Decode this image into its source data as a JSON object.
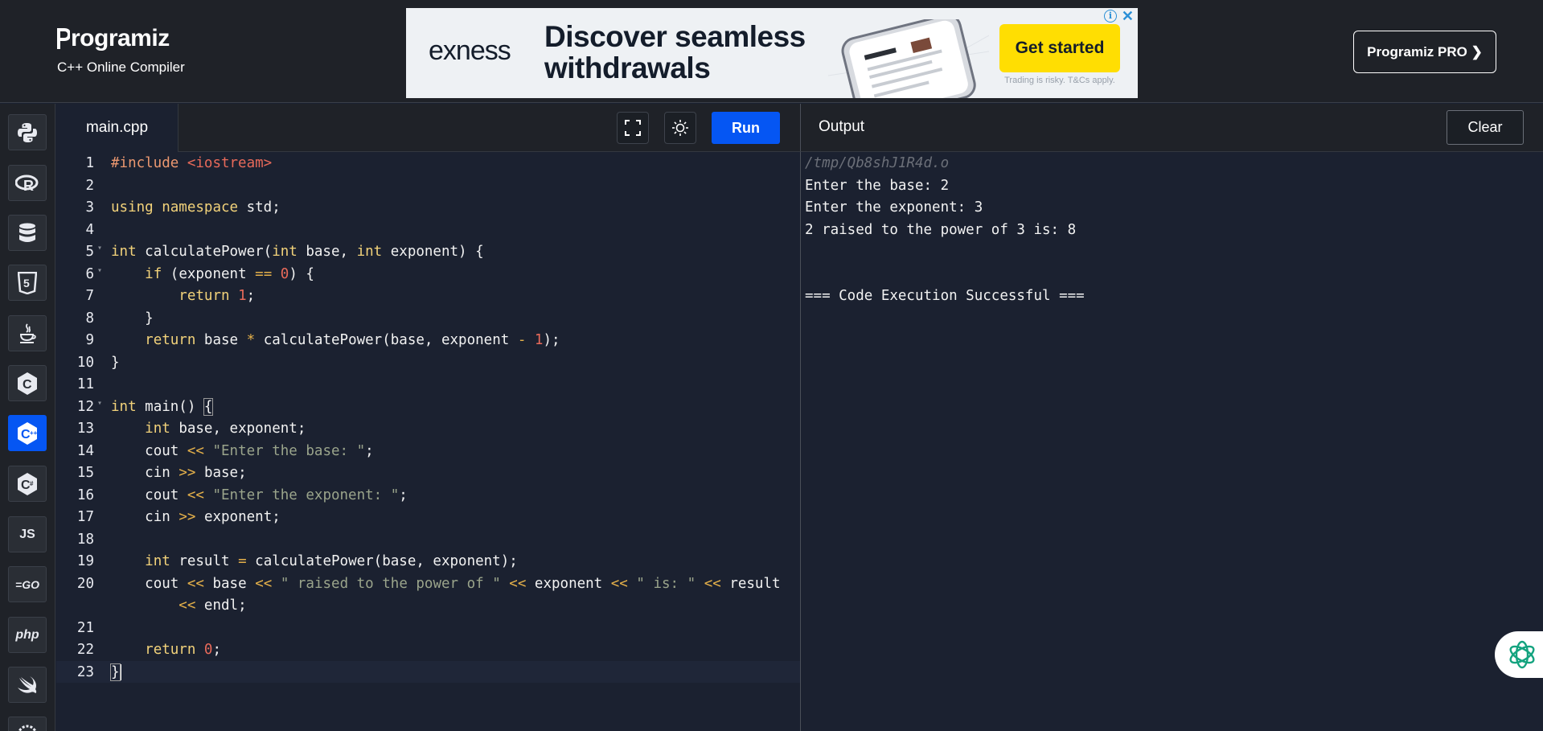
{
  "header": {
    "logo_text": "rogramiz",
    "subtitle": "C++ Online Compiler",
    "pro_button": "Programiz PRO ❯"
  },
  "ad": {
    "brand": "exness",
    "headline": "Discover seamless\nwithdrawals",
    "cta": "Get started",
    "disclaimer": "Trading is risky. T&Cs apply.",
    "info_icon": "i",
    "close_icon": "✕"
  },
  "sidebar": {
    "items": [
      {
        "name": "python",
        "icon": "python-icon"
      },
      {
        "name": "r",
        "icon": "r-icon",
        "label": "R"
      },
      {
        "name": "sql",
        "icon": "database-icon"
      },
      {
        "name": "html",
        "icon": "html5-icon",
        "label": "5"
      },
      {
        "name": "java",
        "icon": "java-icon"
      },
      {
        "name": "c",
        "icon": "c-icon",
        "label": "C"
      },
      {
        "name": "cpp",
        "icon": "cpp-icon",
        "label": "C",
        "active": true
      },
      {
        "name": "csharp",
        "icon": "csharp-icon",
        "label": "C"
      },
      {
        "name": "javascript",
        "icon": "js-icon",
        "label": "JS"
      },
      {
        "name": "go",
        "icon": "go-icon",
        "label": "=GO"
      },
      {
        "name": "php",
        "icon": "php-icon",
        "label": "php"
      },
      {
        "name": "swift",
        "icon": "swift-icon"
      },
      {
        "name": "rust",
        "icon": "rust-icon",
        "label": "R"
      }
    ]
  },
  "editor": {
    "file_tab": "main.cpp",
    "run_button": "Run",
    "line_numbers": [
      "1",
      "2",
      "3",
      "4",
      "5",
      "6",
      "7",
      "8",
      "9",
      "10",
      "11",
      "12",
      "13",
      "14",
      "15",
      "16",
      "17",
      "18",
      "19",
      "20",
      "",
      "21",
      "22",
      "23"
    ],
    "code": {
      "l1a": "#include",
      "l1b": "<iostream>",
      "l3a": "using",
      "l3b": "namespace",
      "l3c": "std;",
      "l5a": "int",
      "l5b": "calculatePower(",
      "l5c": "int",
      "l5d": "base,",
      "l5e": "int",
      "l5f": "exponent) {",
      "l6a": "if",
      "l6b": "(exponent",
      "l6c": "==",
      "l6d": "0",
      "l6e": ") {",
      "l7a": "return",
      "l7b": "1",
      "l7c": ";",
      "l8": "}",
      "l9a": "return",
      "l9b": "base",
      "l9c": "*",
      "l9d": "calculatePower(base, exponent",
      "l9e": "-",
      "l9f": "1",
      "l9g": ");",
      "l10": "}",
      "l12a": "int",
      "l12b": "main() ",
      "l12c": "{",
      "l13a": "int",
      "l13b": "base, exponent;",
      "l14a": "cout",
      "l14b": "<<",
      "l14c": "\"Enter the base: \"",
      "l14d": ";",
      "l15a": "cin",
      "l15b": ">>",
      "l15c": "base;",
      "l16a": "cout",
      "l16b": "<<",
      "l16c": "\"Enter the exponent: \"",
      "l16d": ";",
      "l17a": "cin",
      "l17b": ">>",
      "l17c": "exponent;",
      "l19a": "int",
      "l19b": "result",
      "l19c": "=",
      "l19d": "calculatePower(base, exponent);",
      "l20a": "cout",
      "l20b": "<<",
      "l20c": "base",
      "l20d": "<<",
      "l20e": "\" raised to the power of \"",
      "l20f": "<<",
      "l20g": "exponent",
      "l20h": "<<",
      "l20i": "\" is: \"",
      "l20j": "<<",
      "l20k": "result",
      "l20w1": "<<",
      "l20w2": "endl;",
      "l22a": "return",
      "l22b": "0",
      "l22c": ";",
      "l23": "}"
    }
  },
  "output": {
    "title": "Output",
    "clear_button": "Clear",
    "lines": [
      "/tmp/Qb8shJ1R4d.o",
      "Enter the base: 2",
      "Enter the exponent: 3",
      "2 raised to the power of 3 is: 8",
      "",
      "",
      "=== Code Execution Successful ==="
    ]
  }
}
